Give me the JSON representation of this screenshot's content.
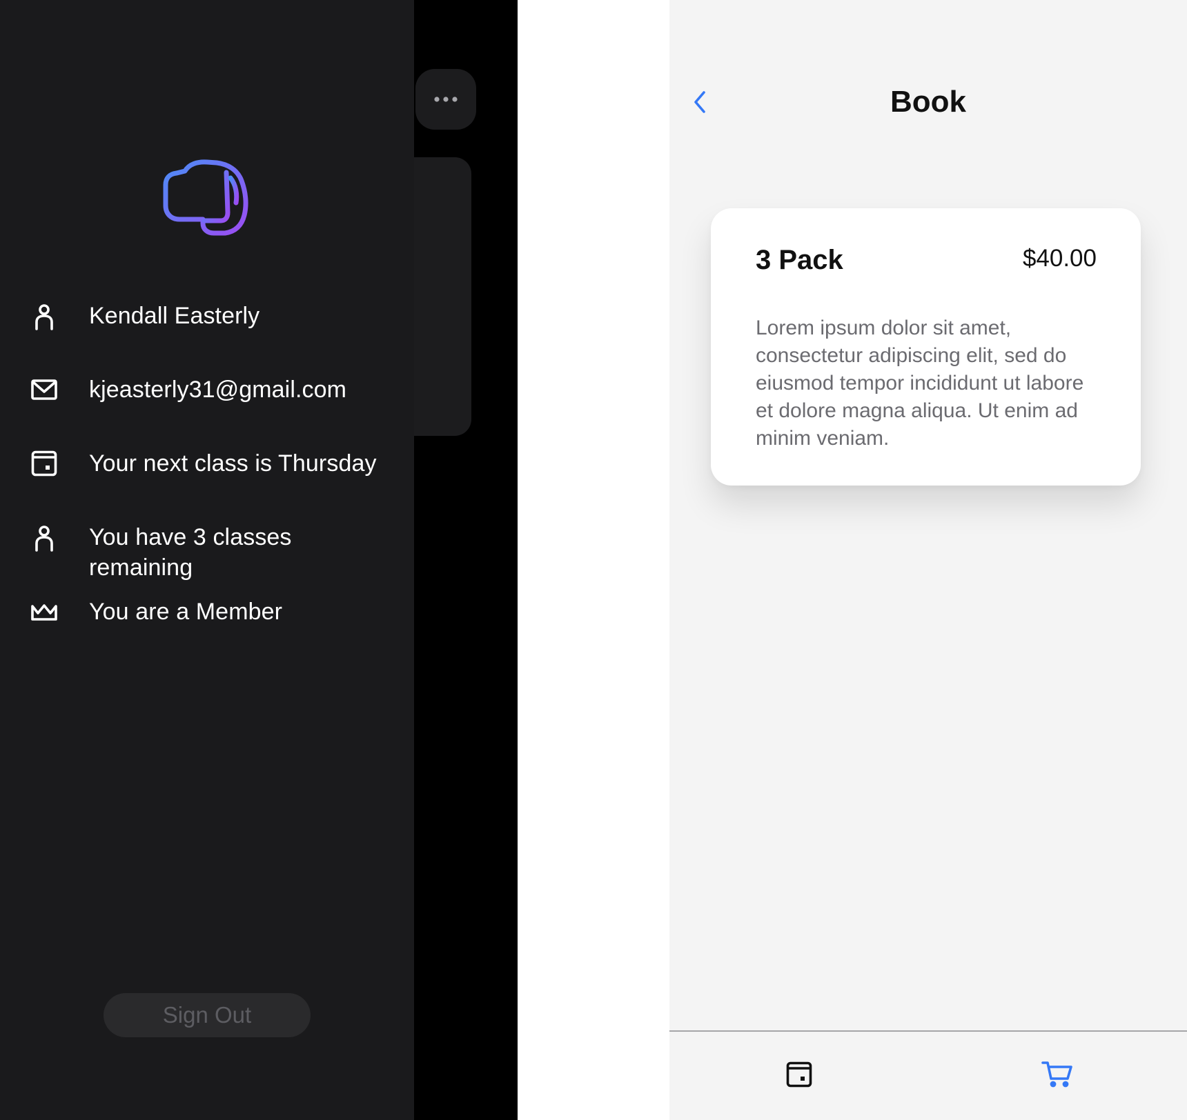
{
  "left_screen": {
    "background_more_icon": "more-horizontal-icon",
    "drawer": {
      "logo_icon": "fist-bump-logo",
      "items": [
        {
          "icon": "person-icon",
          "text": "Kendall Easterly"
        },
        {
          "icon": "mail-icon",
          "text": "kjeasterly31@gmail.com"
        },
        {
          "icon": "calendar-icon",
          "text": "Your next class is Thursday"
        },
        {
          "icon": "person-icon",
          "text": "You have 3 classes remaining"
        },
        {
          "icon": "crown-icon",
          "text": "You are a Member"
        }
      ],
      "sign_out_label": "Sign Out"
    }
  },
  "right_screen": {
    "header": {
      "back_icon": "chevron-left-icon",
      "title": "Book"
    },
    "pack_card": {
      "name": "3 Pack",
      "price": "$40.00",
      "description": "Lorem ipsum dolor sit amet, consectetur adipiscing elit, sed do eiusmod tempor incididunt ut labore et dolore magna aliqua. Ut enim ad minim veniam."
    },
    "tab_bar": {
      "tabs": [
        {
          "icon": "calendar-icon",
          "active": false
        },
        {
          "icon": "cart-icon",
          "active": true
        }
      ]
    }
  },
  "colors": {
    "accent": "#3478f6",
    "logo_gradient_start": "#4c8df6",
    "logo_gradient_end": "#9b4df2",
    "drawer_background": "#1a1a1c",
    "light_background": "#f4f4f4"
  }
}
